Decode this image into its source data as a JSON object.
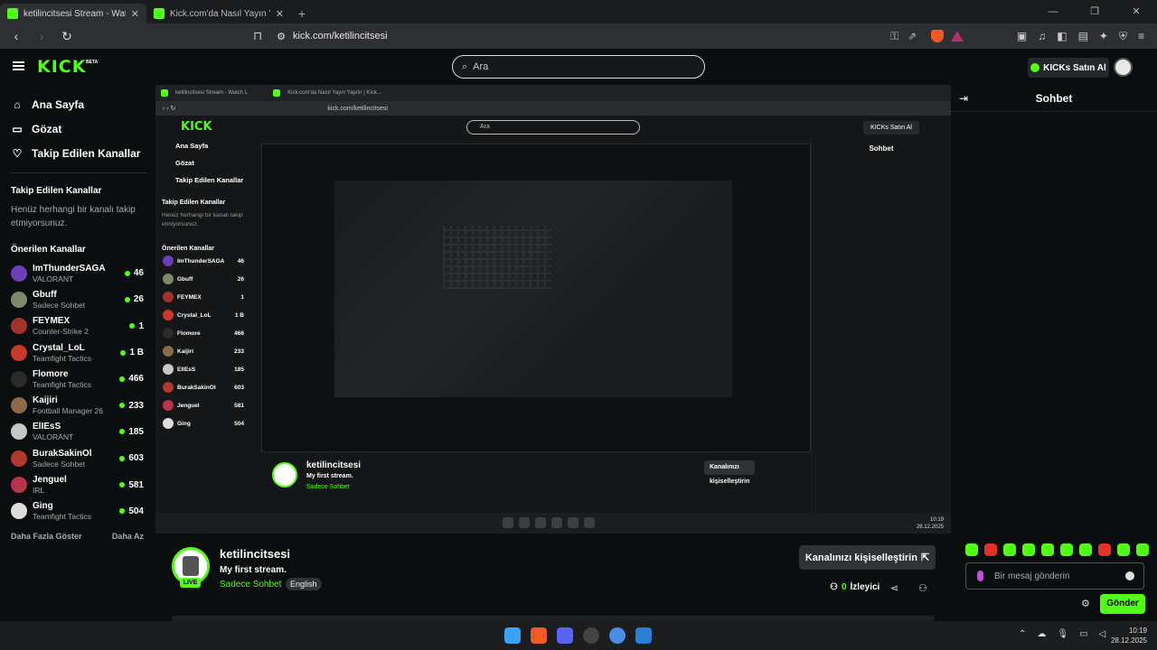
{
  "browser": {
    "tabs": [
      {
        "title": "ketilincitsesi Stream - Watch L",
        "active": true
      },
      {
        "title": "Kick.com'da Nasıl Yayın Yapılır | Kick...",
        "active": false
      }
    ],
    "url": "kick.com/ketilincitsesi"
  },
  "header": {
    "logo": "KICK",
    "beta": "BETA",
    "search_placeholder": "Ara",
    "buy_kicks": "KICKs Satın Al"
  },
  "sidebar": {
    "menu": [
      {
        "label": "Ana Sayfa",
        "icon": "home-icon"
      },
      {
        "label": "Gözat",
        "icon": "browse-icon"
      },
      {
        "label": "Takip Edilen Kanallar",
        "icon": "heart-icon"
      }
    ],
    "followed_title": "Takip Edilen Kanallar",
    "followed_empty": "Henüz herhangi bir kanalı takip etmiyorsunuz.",
    "recommended_title": "Önerilen Kanallar",
    "channels": [
      {
        "name": "ImThunderSAGA",
        "category": "VALORANT",
        "viewers": "46"
      },
      {
        "name": "Gbuff",
        "category": "Sadece Sohbet",
        "viewers": "26"
      },
      {
        "name": "FEYMEX",
        "category": "Counter-Strike 2",
        "viewers": "1"
      },
      {
        "name": "Crystal_LoL",
        "category": "Teamfight Tactics",
        "viewers": "1 B"
      },
      {
        "name": "Flomore",
        "category": "Teamfight Tactics",
        "viewers": "466"
      },
      {
        "name": "Kaijiri",
        "category": "Football Manager 26",
        "viewers": "233"
      },
      {
        "name": "ElIEsS",
        "category": "VALORANT",
        "viewers": "185"
      },
      {
        "name": "BurakSakinOl",
        "category": "Sadece Sohbet",
        "viewers": "603"
      },
      {
        "name": "Jenguel",
        "category": "IRL",
        "viewers": "581"
      },
      {
        "name": "Ging",
        "category": "Teamfight Tactics",
        "viewers": "504"
      }
    ],
    "show_more": "Daha Fazla Göster",
    "show_less": "Daha Az"
  },
  "stream": {
    "channel": "ketilincitsesi",
    "title": "My first stream.",
    "category": "Sadece Sohbet",
    "language": "English",
    "live_badge": "LIVE",
    "customize_button": "Kanalınızı kişiselleştirin",
    "viewers_count": "0",
    "viewers_label": "İzleyici"
  },
  "chat": {
    "title": "Sohbet",
    "input_placeholder": "Bir mesaj gönderin",
    "send_button": "Gönder"
  },
  "taskbar": {
    "time": "10:19",
    "date": "28.12.2025"
  },
  "colors": {
    "accent": "#53fc18",
    "background": "#0b0e0f"
  }
}
